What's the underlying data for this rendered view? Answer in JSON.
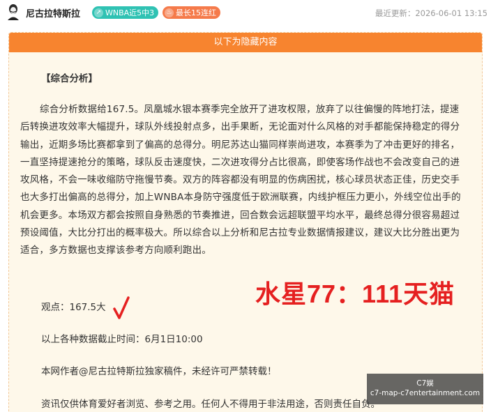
{
  "header": {
    "author": "尼古拉特斯拉",
    "badges": [
      {
        "label": "WNBA近5中3",
        "icon": "trend-icon",
        "color": "#2fc2b3"
      },
      {
        "label": "最长15连红",
        "icon": "flame-icon",
        "color": "#f57a4a"
      }
    ],
    "updated": "最近更新：2026-06-01 13:15"
  },
  "card": {
    "banner": "以下为隐藏内容",
    "section_title": "【综合分析】",
    "analysis": "综合分析数据给167.5。凤凰城水银本赛季完全放开了进攻权限，放弃了以往偏慢的阵地打法，提速后转换进攻效率大幅提升，球队外线投射点多，出手果断，无论面对什么风格的对手都能保持稳定的得分输出，近期多场比赛都拿到了偏高的总得分。明尼苏达山猫同样崇尚进攻，本赛季为了冲击更好的排名，一直坚持提速抢分的策略，球队反击速度快，二次进攻得分占比很高，即使客场作战也不会改变自己的进攻风格，不会一味收缩防守拖慢节奏。双方的阵容都没有明显的伤病困扰，核心球员状态正佳，历史交手也大多打出偏高的总得分，加上WNBA本身防守强度低于欧洲联赛，内线护框压力更小，外线空位出手的机会更多。本场双方都会按照自身熟悉的节奏推进，回合数会远超联盟平均水平，最终总得分很容易超过预设阈值，大比分打出的概率极大。所以综合以上分析和尼古拉专业数据情报建议，建议大比分胜出更为适合，多方数据也支撑该参考方向顺利跑出。",
    "view": "观点：167.5大",
    "score": "水星77：111天猫",
    "cutoff": "以上各种数据截止时间：6月1日10:00",
    "author_note": "本网作者@尼古拉特斯拉独家稿件，未经许可严禁转载！",
    "disclaimer": "资讯仅供体育爱好者浏览、参考之用。任何人不得用于非法用途，否则责任自负。"
  },
  "watermark": {
    "line1": "C7娱",
    "line2": "c7-map-c7entertainment.com"
  },
  "colors": {
    "banner": "#f7842f",
    "card_bg": "#fef8ea",
    "score": "#e52020",
    "check": "#e52020"
  }
}
